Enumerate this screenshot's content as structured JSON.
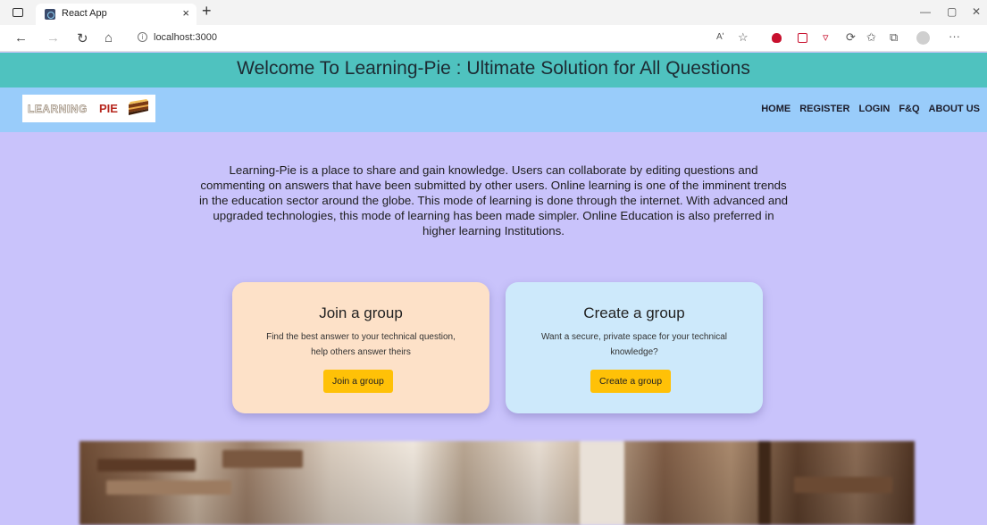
{
  "browser": {
    "tab_title": "React App",
    "tab_close": "×",
    "new_tab": "+",
    "url": "localhost:3000",
    "info_glyph": "i",
    "read_aloud": "Aʹ",
    "more": "···"
  },
  "banner": {
    "title": "Welcome To Learning-Pie : Ultimate Solution for All Questions"
  },
  "logo": {
    "word1": "LEARNING",
    "word2": "PIE"
  },
  "nav": {
    "items": [
      "HOME",
      "REGISTER",
      "LOGIN",
      "F&Q",
      "ABOUT US"
    ]
  },
  "intro": {
    "text": "Learning-Pie is a place to share and gain knowledge. Users can collaborate by editing questions and commenting on answers that have been submitted by other users. Online learning is one of the imminent trends in the education sector around the globe. This mode of learning is done through the internet. With advanced and upgraded technologies, this mode of learning has been made simpler. Online Education is also preferred in higher learning Institutions."
  },
  "cards": {
    "join": {
      "title": "Join a group",
      "desc": "Find the best answer to your technical question, help others answer theirs",
      "button": "Join a group",
      "bg": "#fde1c8"
    },
    "create": {
      "title": "Create a group",
      "desc": "Want a secure, private space for your technical knowledge?",
      "button": "Create a group",
      "bg": "#cde9fb"
    }
  },
  "colors": {
    "page_bg": "#c9c3fb",
    "banner_bg": "#4fc2bf",
    "navbar_bg": "#99ccfa",
    "button": "#ffc107"
  }
}
